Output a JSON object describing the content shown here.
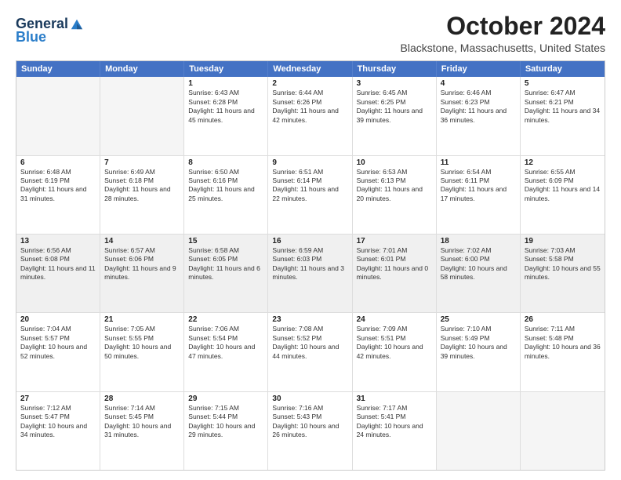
{
  "logo": {
    "line1": "General",
    "line2": "Blue",
    "tagline": ""
  },
  "title": "October 2024",
  "subtitle": "Blackstone, Massachusetts, United States",
  "header_days": [
    "Sunday",
    "Monday",
    "Tuesday",
    "Wednesday",
    "Thursday",
    "Friday",
    "Saturday"
  ],
  "weeks": [
    [
      {
        "day": "",
        "text": "",
        "empty": true
      },
      {
        "day": "",
        "text": "",
        "empty": true
      },
      {
        "day": "1",
        "text": "Sunrise: 6:43 AM\nSunset: 6:28 PM\nDaylight: 11 hours and 45 minutes."
      },
      {
        "day": "2",
        "text": "Sunrise: 6:44 AM\nSunset: 6:26 PM\nDaylight: 11 hours and 42 minutes."
      },
      {
        "day": "3",
        "text": "Sunrise: 6:45 AM\nSunset: 6:25 PM\nDaylight: 11 hours and 39 minutes."
      },
      {
        "day": "4",
        "text": "Sunrise: 6:46 AM\nSunset: 6:23 PM\nDaylight: 11 hours and 36 minutes."
      },
      {
        "day": "5",
        "text": "Sunrise: 6:47 AM\nSunset: 6:21 PM\nDaylight: 11 hours and 34 minutes."
      }
    ],
    [
      {
        "day": "6",
        "text": "Sunrise: 6:48 AM\nSunset: 6:19 PM\nDaylight: 11 hours and 31 minutes."
      },
      {
        "day": "7",
        "text": "Sunrise: 6:49 AM\nSunset: 6:18 PM\nDaylight: 11 hours and 28 minutes."
      },
      {
        "day": "8",
        "text": "Sunrise: 6:50 AM\nSunset: 6:16 PM\nDaylight: 11 hours and 25 minutes."
      },
      {
        "day": "9",
        "text": "Sunrise: 6:51 AM\nSunset: 6:14 PM\nDaylight: 11 hours and 22 minutes."
      },
      {
        "day": "10",
        "text": "Sunrise: 6:53 AM\nSunset: 6:13 PM\nDaylight: 11 hours and 20 minutes."
      },
      {
        "day": "11",
        "text": "Sunrise: 6:54 AM\nSunset: 6:11 PM\nDaylight: 11 hours and 17 minutes."
      },
      {
        "day": "12",
        "text": "Sunrise: 6:55 AM\nSunset: 6:09 PM\nDaylight: 11 hours and 14 minutes."
      }
    ],
    [
      {
        "day": "13",
        "text": "Sunrise: 6:56 AM\nSunset: 6:08 PM\nDaylight: 11 hours and 11 minutes.",
        "shaded": true
      },
      {
        "day": "14",
        "text": "Sunrise: 6:57 AM\nSunset: 6:06 PM\nDaylight: 11 hours and 9 minutes.",
        "shaded": true
      },
      {
        "day": "15",
        "text": "Sunrise: 6:58 AM\nSunset: 6:05 PM\nDaylight: 11 hours and 6 minutes.",
        "shaded": true
      },
      {
        "day": "16",
        "text": "Sunrise: 6:59 AM\nSunset: 6:03 PM\nDaylight: 11 hours and 3 minutes.",
        "shaded": true
      },
      {
        "day": "17",
        "text": "Sunrise: 7:01 AM\nSunset: 6:01 PM\nDaylight: 11 hours and 0 minutes.",
        "shaded": true
      },
      {
        "day": "18",
        "text": "Sunrise: 7:02 AM\nSunset: 6:00 PM\nDaylight: 10 hours and 58 minutes.",
        "shaded": true
      },
      {
        "day": "19",
        "text": "Sunrise: 7:03 AM\nSunset: 5:58 PM\nDaylight: 10 hours and 55 minutes.",
        "shaded": true
      }
    ],
    [
      {
        "day": "20",
        "text": "Sunrise: 7:04 AM\nSunset: 5:57 PM\nDaylight: 10 hours and 52 minutes."
      },
      {
        "day": "21",
        "text": "Sunrise: 7:05 AM\nSunset: 5:55 PM\nDaylight: 10 hours and 50 minutes."
      },
      {
        "day": "22",
        "text": "Sunrise: 7:06 AM\nSunset: 5:54 PM\nDaylight: 10 hours and 47 minutes."
      },
      {
        "day": "23",
        "text": "Sunrise: 7:08 AM\nSunset: 5:52 PM\nDaylight: 10 hours and 44 minutes."
      },
      {
        "day": "24",
        "text": "Sunrise: 7:09 AM\nSunset: 5:51 PM\nDaylight: 10 hours and 42 minutes."
      },
      {
        "day": "25",
        "text": "Sunrise: 7:10 AM\nSunset: 5:49 PM\nDaylight: 10 hours and 39 minutes."
      },
      {
        "day": "26",
        "text": "Sunrise: 7:11 AM\nSunset: 5:48 PM\nDaylight: 10 hours and 36 minutes."
      }
    ],
    [
      {
        "day": "27",
        "text": "Sunrise: 7:12 AM\nSunset: 5:47 PM\nDaylight: 10 hours and 34 minutes."
      },
      {
        "day": "28",
        "text": "Sunrise: 7:14 AM\nSunset: 5:45 PM\nDaylight: 10 hours and 31 minutes."
      },
      {
        "day": "29",
        "text": "Sunrise: 7:15 AM\nSunset: 5:44 PM\nDaylight: 10 hours and 29 minutes."
      },
      {
        "day": "30",
        "text": "Sunrise: 7:16 AM\nSunset: 5:43 PM\nDaylight: 10 hours and 26 minutes."
      },
      {
        "day": "31",
        "text": "Sunrise: 7:17 AM\nSunset: 5:41 PM\nDaylight: 10 hours and 24 minutes."
      },
      {
        "day": "",
        "text": "",
        "empty": true
      },
      {
        "day": "",
        "text": "",
        "empty": true
      }
    ]
  ]
}
